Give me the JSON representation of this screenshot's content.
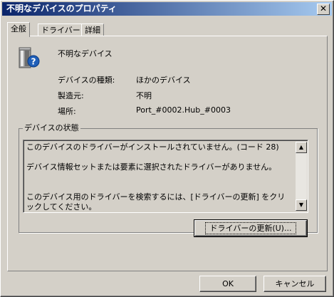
{
  "window": {
    "title": "不明なデバイスのプロパティ",
    "close_glyph": "✕"
  },
  "tabs": [
    {
      "label": "全般",
      "active": true
    },
    {
      "label": "ドライバー",
      "active": false
    },
    {
      "label": "詳細",
      "active": false
    }
  ],
  "device": {
    "icon": "unknown-device-icon",
    "name": "不明なデバイス",
    "properties": [
      {
        "label": "デバイスの種類:",
        "value": "ほかのデバイス"
      },
      {
        "label": "製造元:",
        "value": "不明"
      },
      {
        "label": "場所:",
        "value": "Port_#0002.Hub_#0003"
      }
    ]
  },
  "status": {
    "group_label": "デバイスの状態",
    "lines": [
      "このデバイスのドライバーがインストールされていません。(コード 28)",
      "デバイス情報セットまたは要素に選択されたドライバーがありません。",
      "このデバイス用のドライバーを検索するには、[ドライバーの更新] をクリックしてください。"
    ],
    "scroll_up_glyph": "▲",
    "scroll_down_glyph": "▼"
  },
  "buttons": {
    "update_driver": "ドライバーの更新(U)...",
    "ok": "OK",
    "cancel": "キャンセル"
  },
  "colors": {
    "title_gradient_start": "#0a246a",
    "title_gradient_end": "#a6caf0",
    "face": "#d4d0c8"
  }
}
